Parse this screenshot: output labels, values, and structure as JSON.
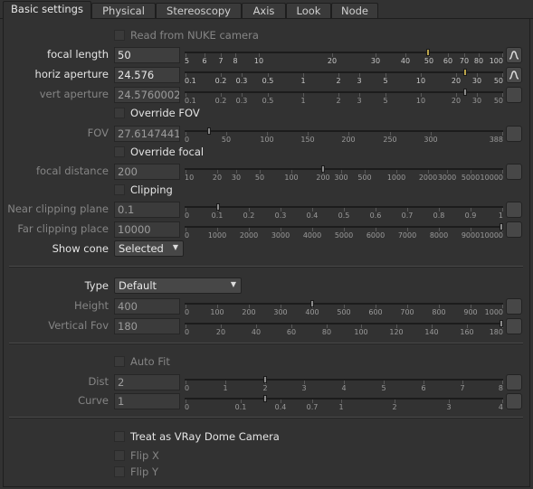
{
  "tabs": [
    {
      "label": "Basic settings",
      "active": true
    },
    {
      "label": "Physical",
      "active": false
    },
    {
      "label": "Stereoscopy",
      "active": false
    },
    {
      "label": "Axis",
      "active": false
    },
    {
      "label": "Look",
      "active": false
    },
    {
      "label": "Node",
      "active": false
    }
  ],
  "read_from_nuke": {
    "label": "Read from NUKE camera",
    "checked": false,
    "enabled": false
  },
  "focal_length": {
    "label": "focal length",
    "value": "50",
    "enabled": true,
    "animated": true,
    "slider_value": 50,
    "ticks": [
      "5",
      "6",
      "7",
      "8",
      "10",
      "20",
      "30",
      "40",
      "50",
      "60",
      "70",
      "80",
      "100"
    ]
  },
  "horiz_aperture": {
    "label": "horiz aperture",
    "value": "24.576",
    "enabled": true,
    "animated": true,
    "slider_value": 24.576,
    "ticks": [
      "0.1",
      "0.2",
      "0.3",
      "0.5",
      "1",
      "2",
      "3",
      "5",
      "10",
      "20",
      "30",
      "50"
    ]
  },
  "vert_aperture": {
    "label": "vert aperture",
    "value": "24.5760002",
    "enabled": false,
    "animated": false,
    "slider_value": 24.576,
    "ticks": [
      "0.1",
      "0.2",
      "0.3",
      "0.5",
      "1",
      "2",
      "3",
      "5",
      "10",
      "20",
      "30",
      "50"
    ]
  },
  "override_fov": {
    "label": "Override FOV",
    "checked": false,
    "enabled": true
  },
  "fov": {
    "label": "FOV",
    "value": "27.6147441",
    "enabled": false,
    "slider_value": 27.6147441,
    "ticks": [
      "0",
      "50",
      "100",
      "150",
      "200",
      "250",
      "300",
      "388"
    ]
  },
  "override_focal": {
    "label": "Override focal",
    "checked": false,
    "enabled": true
  },
  "focal_distance": {
    "label": "focal distance",
    "value": "200",
    "enabled": false,
    "slider_value": 200,
    "ticks": [
      "10",
      "20",
      "30",
      "50",
      "100",
      "200",
      "300",
      "500",
      "1000",
      "2000",
      "3000",
      "5000",
      "10000"
    ]
  },
  "clipping": {
    "label": "Clipping",
    "checked": false,
    "enabled": true
  },
  "near_clipping": {
    "label": "Near clipping plane",
    "value": "0.1",
    "enabled": false,
    "slider_value": 0.1,
    "ticks": [
      "0",
      "0.1",
      "0.2",
      "0.3",
      "0.4",
      "0.5",
      "0.6",
      "0.7",
      "0.8",
      "0.9",
      "1"
    ]
  },
  "far_clipping": {
    "label": "Far clipping place",
    "value": "10000",
    "enabled": false,
    "slider_value": 10000,
    "ticks": [
      "0",
      "1000",
      "2000",
      "3000",
      "4000",
      "5000",
      "6000",
      "7000",
      "8000",
      "9000",
      "10000"
    ]
  },
  "show_cone": {
    "label": "Show cone",
    "value": "Selected"
  },
  "type": {
    "label": "Type",
    "value": "Default"
  },
  "height": {
    "label": "Height",
    "value": "400",
    "enabled": false,
    "slider_value": 400,
    "ticks": [
      "0",
      "100",
      "200",
      "300",
      "400",
      "500",
      "600",
      "700",
      "800",
      "900",
      "1000"
    ]
  },
  "vertical_fov": {
    "label": "Vertical Fov",
    "value": "180",
    "enabled": false,
    "slider_value": 180,
    "ticks": [
      "0",
      "20",
      "40",
      "60",
      "80",
      "100",
      "120",
      "140",
      "160",
      "180"
    ]
  },
  "auto_fit": {
    "label": "Auto Fit",
    "checked": false,
    "enabled": false
  },
  "dist": {
    "label": "Dist",
    "value": "2",
    "enabled": false,
    "slider_value": 2,
    "ticks": [
      "0",
      "1",
      "2",
      "3",
      "4",
      "5",
      "6",
      "7",
      "8"
    ]
  },
  "curve": {
    "label": "Curve",
    "value": "1",
    "enabled": false,
    "slider_value": 1,
    "ticks": [
      "0",
      "0.1",
      "0.4",
      "0.7",
      "1",
      "2",
      "3",
      "4"
    ]
  },
  "treat_dome": {
    "label": "Treat as VRay Dome Camera",
    "checked": false,
    "enabled": true
  },
  "flip_x": {
    "label": "Flip X",
    "checked": false,
    "enabled": false
  },
  "flip_y": {
    "label": "Flip Y",
    "checked": false,
    "enabled": false
  }
}
